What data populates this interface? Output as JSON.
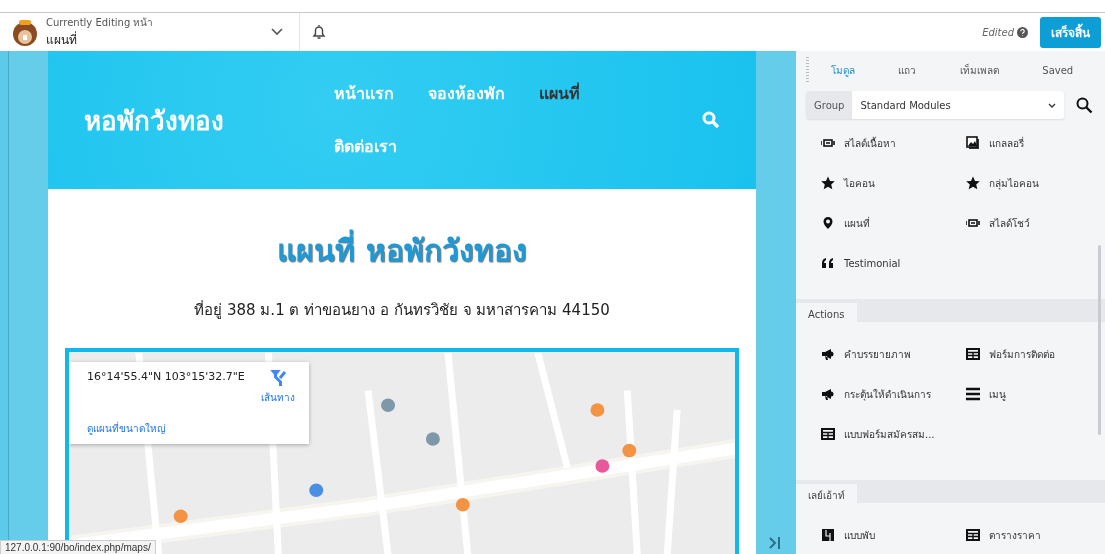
{
  "toolbar": {
    "subtitle": "Currently Editing หน้า",
    "title": "แผนที่",
    "status": "Edited",
    "done_button": "เสร็จสิ้น"
  },
  "site": {
    "logo": "หอพักวังทอง",
    "nav": [
      {
        "label": "หน้าแรก",
        "selected": false
      },
      {
        "label": "จองห้องพัก",
        "selected": false
      },
      {
        "label": "แผนที่",
        "selected": true
      },
      {
        "label": "ติดต่อเรา",
        "selected": false
      }
    ],
    "heading": "แผนที่ หอพักวังทอง",
    "address": "ที่อยู่ 388 ม.1 ต ท่าขอนยาง อ กันทรวิชัย จ มหาสารคาม 44150",
    "map_card": {
      "coords": "16°14'55.4\"N 103°15'32.7\"E",
      "directions": "เส้นทาง",
      "larger_map": "ดูแผนที่ขนาดใหญ่"
    }
  },
  "panel": {
    "tabs": [
      {
        "label": "โมดูล",
        "selected": true
      },
      {
        "label": "แถว",
        "selected": false
      },
      {
        "label": "เท็มเพลต",
        "selected": false
      },
      {
        "label": "Saved",
        "selected": false
      }
    ],
    "group_label": "Group",
    "group_value": "Standard Modules",
    "sections": [
      {
        "modules": [
          {
            "kind": "slider",
            "label": "สไลด์เนื้อหา"
          },
          {
            "kind": "gallery",
            "label": "แกลลอรี่"
          },
          {
            "kind": "star",
            "label": "ไอคอน"
          },
          {
            "kind": "star",
            "label": "กลุ่มไอคอน"
          },
          {
            "kind": "pin",
            "label": "แผนที่"
          },
          {
            "kind": "slider",
            "label": "สไลด์โชว์"
          },
          {
            "kind": "quote",
            "label": "Testimonial"
          }
        ]
      },
      {
        "title": "Actions",
        "modules": [
          {
            "kind": "megaphone",
            "label": "คำบรรยายภาพ"
          },
          {
            "kind": "table",
            "label": "ฟอร์มการติดต่อ"
          },
          {
            "kind": "megaphone",
            "label": "กระตุ้นให้ดำเนินการ"
          },
          {
            "kind": "menu",
            "label": "เมนู"
          },
          {
            "kind": "table",
            "label": "แบบฟอร์มสมัครสม..."
          }
        ]
      },
      {
        "title": "เลย์เอ้าท์",
        "modules": [
          {
            "kind": "accordion",
            "label": "แบบพับ"
          },
          {
            "kind": "table",
            "label": "ตารางราคา"
          }
        ]
      }
    ]
  },
  "status_url": "127.0.0.1:90/bo/index.php/maps/"
}
